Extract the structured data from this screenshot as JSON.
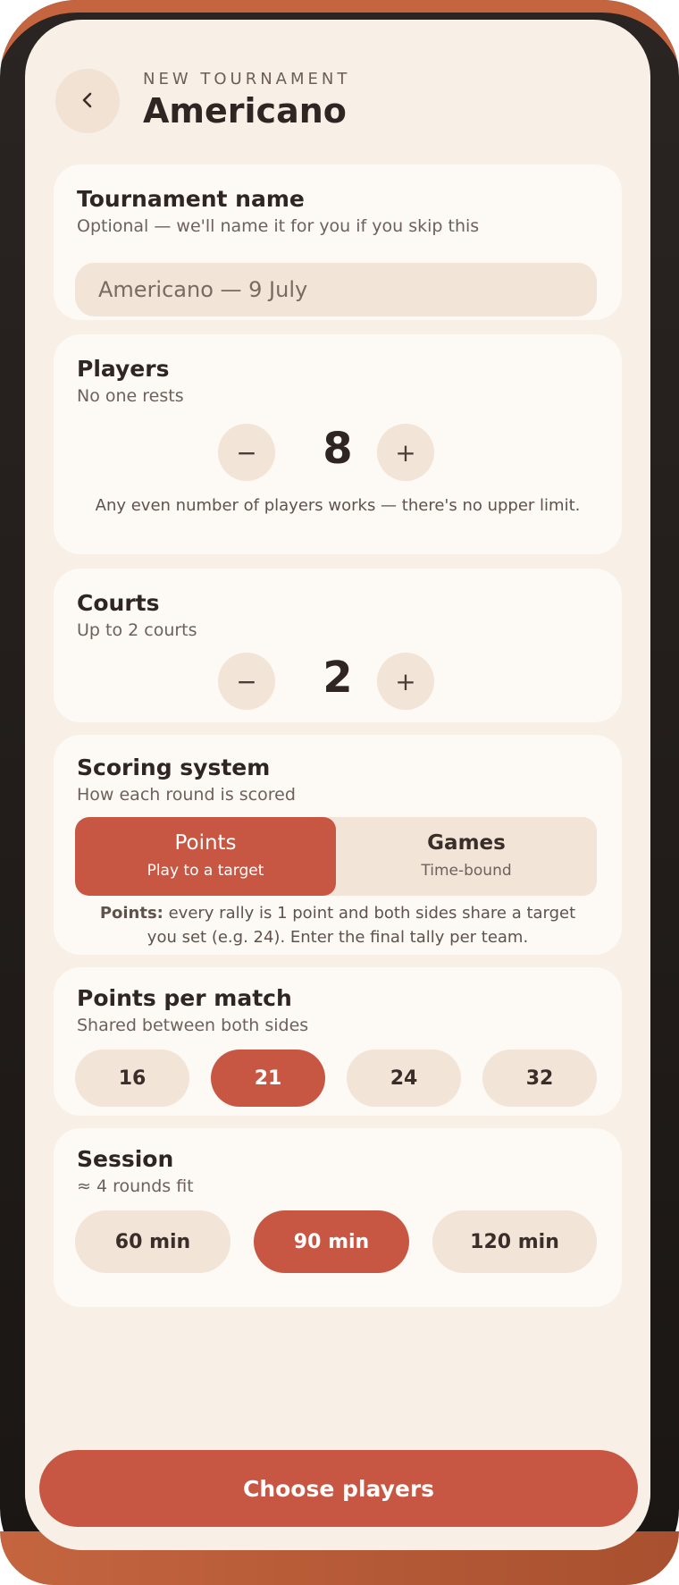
{
  "header": {
    "eyebrow": "NEW TOURNAMENT",
    "title": "Americano",
    "back_icon": "chevron-left-icon"
  },
  "name_card": {
    "title": "Tournament name",
    "subtitle": "Optional — we'll name it for you if you skip this",
    "input_placeholder": "Americano — 9 July"
  },
  "players_card": {
    "title": "Players",
    "subtitle": "No one rests",
    "value": "8",
    "decrement": "−",
    "increment": "+",
    "note": "Any even number of players works — there's no upper limit."
  },
  "courts_card": {
    "title": "Courts",
    "subtitle": "Up to 2 courts",
    "value": "2",
    "decrement": "−",
    "increment": "+"
  },
  "scoring_card": {
    "title": "Scoring system",
    "subtitle": "How each round is scored",
    "options": [
      {
        "label": "Points",
        "sub": "Play to a target",
        "selected": true
      },
      {
        "label": "Games",
        "sub": "Time-bound",
        "selected": false
      }
    ],
    "note_bold": "Points:",
    "note_rest": " every rally is 1 point and both sides share a target you set (e.g. 24). Enter the final tally per team."
  },
  "points_card": {
    "title": "Points per match",
    "subtitle": "Shared between both sides",
    "options": [
      "16",
      "21",
      "24",
      "32"
    ],
    "selected": "21"
  },
  "session_card": {
    "title": "Session",
    "subtitle": "≈ 4 rounds fit",
    "options": [
      "60 min",
      "90 min",
      "120 min"
    ],
    "selected": "90 min"
  },
  "cta": {
    "label": "Choose players"
  },
  "colors": {
    "accent": "#c75743",
    "background": "#f8efe6",
    "card": "#fdf9f5",
    "chip": "#f2e4d6"
  }
}
